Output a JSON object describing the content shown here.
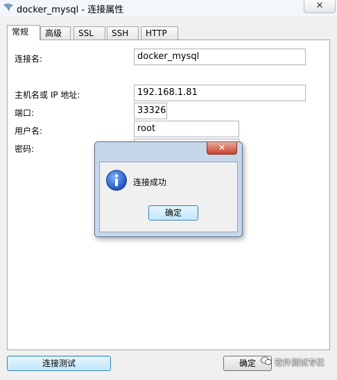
{
  "window": {
    "title": "docker_mysql - 连接属性",
    "close_glyph": "✕"
  },
  "tabs": [
    {
      "label": "常规",
      "active": true
    },
    {
      "label": "高级"
    },
    {
      "label": "SSL"
    },
    {
      "label": "SSH"
    },
    {
      "label": "HTTP"
    }
  ],
  "form": {
    "connection_name_label": "连接名:",
    "connection_name_value": "docker_mysql",
    "host_label": "主机名或 IP 地址:",
    "host_value": "192.168.1.81",
    "port_label": "端口:",
    "port_value": "33326",
    "user_label": "用户名:",
    "user_value": "root",
    "password_label": "密码:",
    "password_mask": "••••••••"
  },
  "buttons": {
    "test_connection": "连接测试",
    "ok": "确定"
  },
  "dialog": {
    "close_glyph": "✕",
    "message": "连接成功",
    "ok_button": "确定",
    "icon": "info-icon"
  },
  "watermark": {
    "text": "软件测试专栏"
  },
  "colors": {
    "accent": "#3c7fb1",
    "close_red": "#c7432c"
  }
}
